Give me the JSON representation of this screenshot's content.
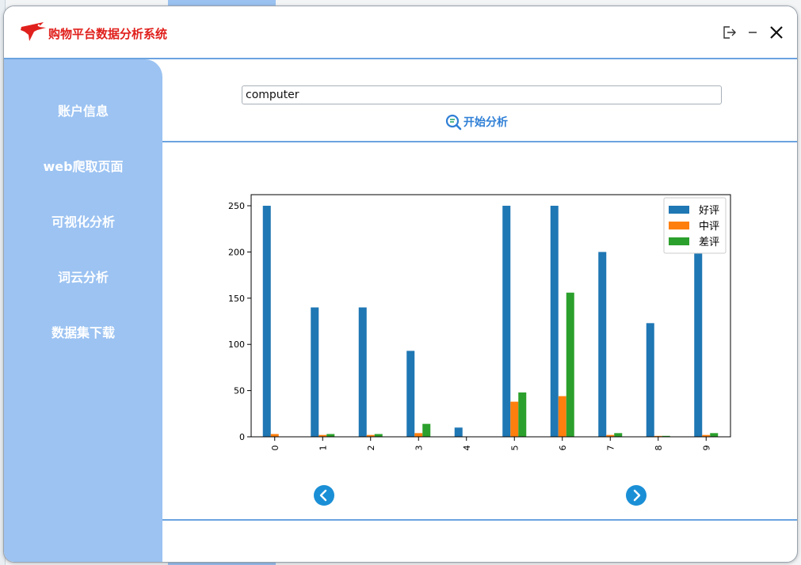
{
  "app": {
    "title": "购物平台数据分析系统"
  },
  "sidebar": {
    "items": [
      {
        "label": "账户信息"
      },
      {
        "label": "web爬取页面"
      },
      {
        "label": "可视化分析"
      },
      {
        "label": "词云分析"
      },
      {
        "label": "数据集下载"
      }
    ]
  },
  "search": {
    "value": "computer"
  },
  "actions": {
    "analyze_label": "开始分析"
  },
  "icons": {
    "logo": "red-bird-logo-icon",
    "logout": "logout-icon",
    "minimize": "minimize-icon",
    "close": "close-icon",
    "analyze": "magnifier-analyze-icon",
    "prev": "chevron-left-icon",
    "next": "chevron-right-icon"
  },
  "colors": {
    "accent": "#6ba3e0",
    "sidebar": "#9cc3f2",
    "title": "#e0201c",
    "nav_button": "#1a8fd6"
  },
  "chart_data": {
    "type": "bar",
    "categories": [
      "0",
      "1",
      "2",
      "3",
      "4",
      "5",
      "6",
      "7",
      "8",
      "9"
    ],
    "series": [
      {
        "name": "好评",
        "color": "#1f77b4",
        "values": [
          250,
          140,
          140,
          93,
          10,
          250,
          250,
          200,
          123,
          200
        ]
      },
      {
        "name": "中评",
        "color": "#ff7f0e",
        "values": [
          3,
          2,
          2,
          4,
          0,
          38,
          44,
          2,
          1,
          2
        ]
      },
      {
        "name": "差评",
        "color": "#2ca02c",
        "values": [
          0,
          3,
          3,
          14,
          0,
          48,
          156,
          4,
          1,
          4
        ]
      }
    ],
    "ylim": [
      0,
      262
    ],
    "yticks": [
      0,
      50,
      100,
      150,
      200,
      250
    ],
    "grid": false,
    "legend": "top-right",
    "xtick_rotation": 90
  }
}
